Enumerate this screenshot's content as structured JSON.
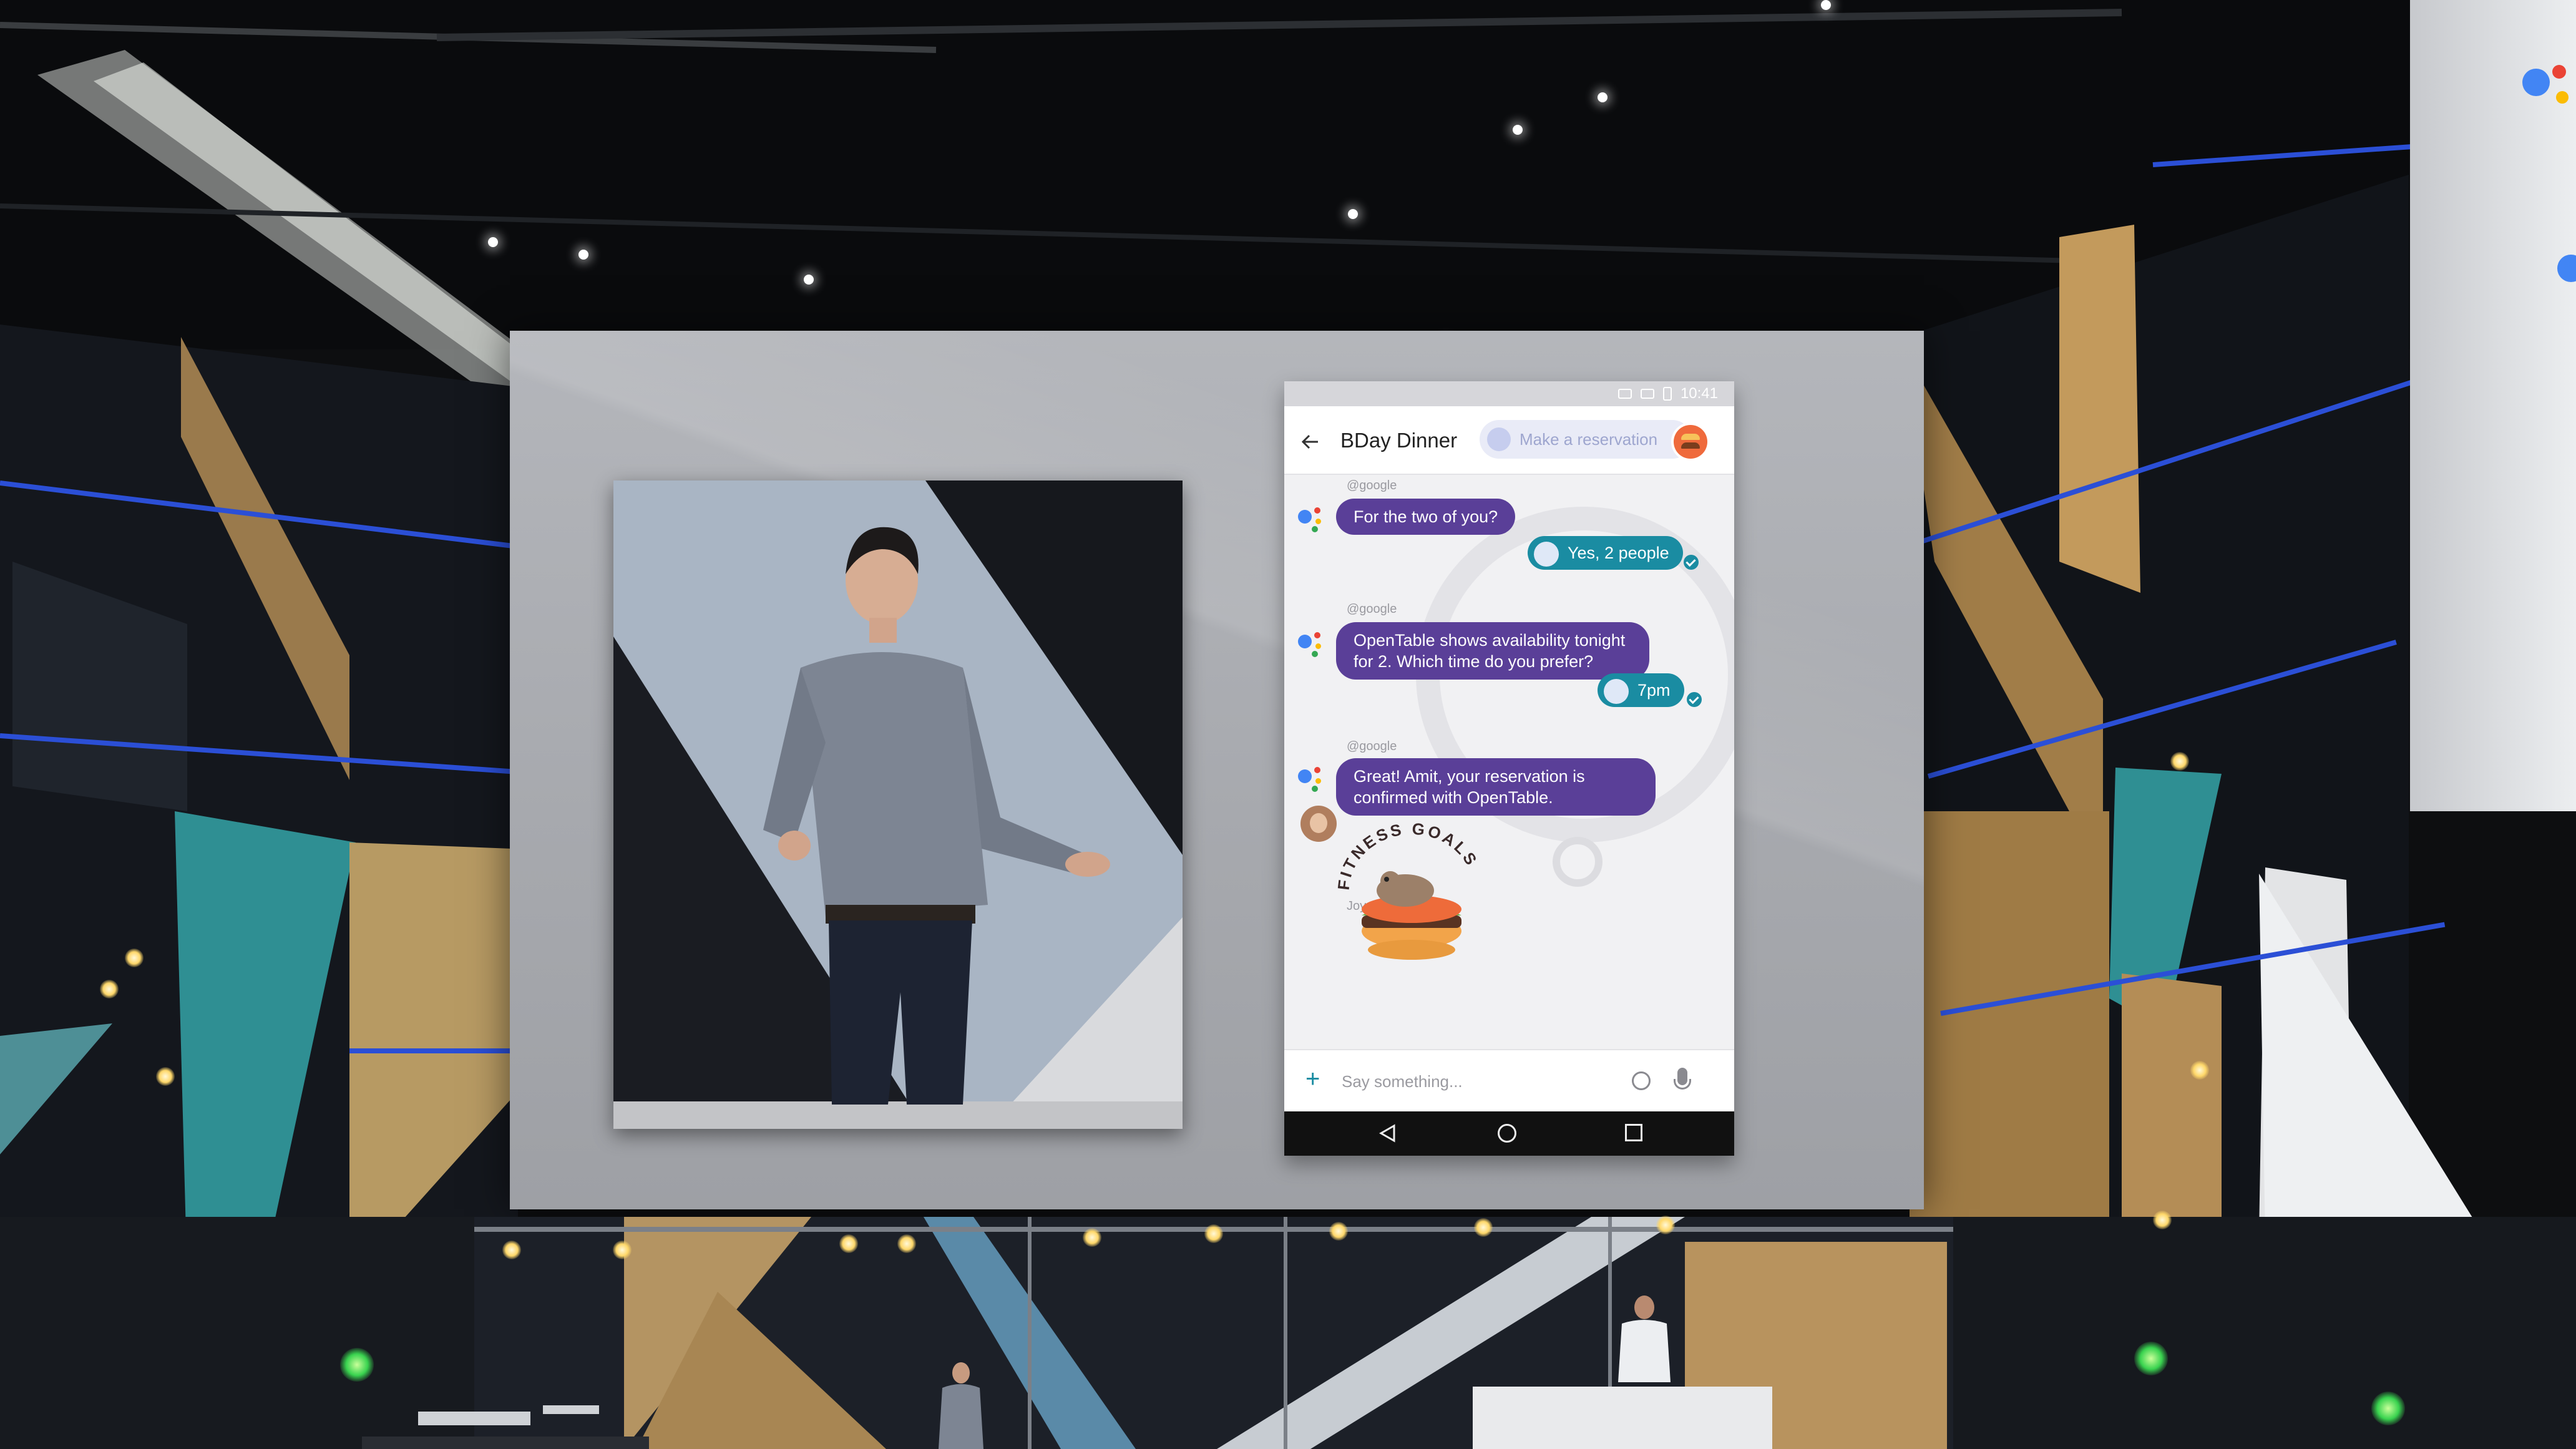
{
  "phone": {
    "status_time": "10:41",
    "title": "BDay Dinner",
    "action_chip": "Make a reservation",
    "messages": [
      {
        "sender": "@google",
        "text": "For the two of you?"
      },
      {
        "reply": "Yes, 2 people"
      },
      {
        "sender": "@google",
        "line1": "OpenTable shows availability tonight",
        "line2": "for 2. Which time do you prefer?"
      },
      {
        "reply": "7pm"
      },
      {
        "sender": "@google",
        "line1": "Great! Amit, your reservation is",
        "line2": "confirmed with OpenTable."
      },
      {
        "sender": "Joy",
        "sticker_text": "FITNESS GOALS"
      }
    ],
    "input_placeholder": "Say something...",
    "icons": [
      "back-arrow-icon",
      "google-assistant-icon",
      "checkmark-icon",
      "plus-icon",
      "emoji-icon",
      "microphone-icon",
      "nav-back-icon",
      "nav-home-icon",
      "nav-recents-icon"
    ]
  },
  "colors": {
    "assistant_bubble": "#5a3f98",
    "user_reply": "#1a8ca2",
    "assistant_blue": "#4285f4",
    "assistant_red": "#ea4335",
    "assistant_yellow": "#fbbc05",
    "assistant_green": "#34a853"
  }
}
